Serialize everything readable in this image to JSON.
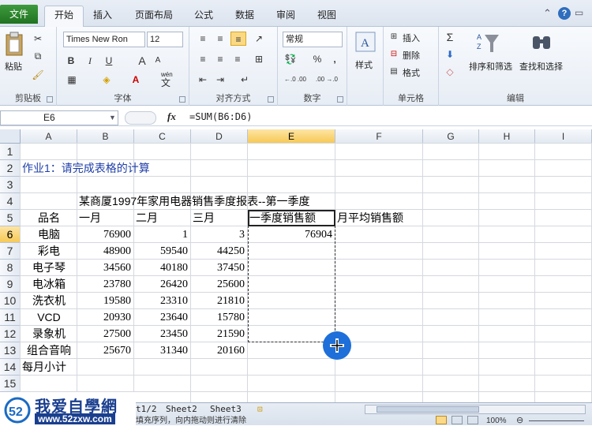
{
  "ribbon_tabs": [
    "文件",
    "开始",
    "插入",
    "页面布局",
    "公式",
    "数据",
    "审阅",
    "视图"
  ],
  "clipboard": {
    "paste": "粘贴",
    "group": "剪贴板"
  },
  "font": {
    "name": "Times New Ron",
    "size": "12",
    "group": "字体",
    "bold": "B",
    "italic": "I",
    "underline": "U",
    "grow": "A",
    "shrink": "A",
    "color": "A",
    "wen": "wén",
    "wen_glyph": "文"
  },
  "alignment": {
    "group": "对齐方式"
  },
  "number": {
    "format": "常规",
    "group": "数字",
    "percent": "%",
    "comma": ",",
    "inc": "←.0 .00",
    "dec": ".00 →.0"
  },
  "styles": {
    "label": "样式"
  },
  "cells": {
    "insert": "插入",
    "delete": "删除",
    "format": "格式",
    "group": "单元格"
  },
  "editing": {
    "sort": "排序和筛选",
    "find": "查找和选择",
    "group": "编辑",
    "sigma": "Σ"
  },
  "formula_bar": {
    "name_box": "E6",
    "fx": "fx",
    "formula": "=SUM(B6:D6)"
  },
  "columns": [
    "A",
    "B",
    "C",
    "D",
    "E",
    "F",
    "G",
    "H",
    "I"
  ],
  "rows": [
    "1",
    "2",
    "3",
    "4",
    "5",
    "6",
    "7",
    "8",
    "9",
    "10",
    "11",
    "12",
    "13",
    "14",
    "15"
  ],
  "sheet": {
    "task": "作业1：请完成表格的计算",
    "title": "某商厦1997年家用电器销售季度报表--第一季度",
    "headers": [
      "品名",
      "一月",
      "二月",
      "三月",
      "一季度销售额",
      "月平均销售额"
    ],
    "data": [
      {
        "name": "电脑",
        "b": "76900",
        "c": "1",
        "d": "3",
        "e": "76904"
      },
      {
        "name": "彩电",
        "b": "48900",
        "c": "59540",
        "d": "44250",
        "e": ""
      },
      {
        "name": "电子琴",
        "b": "34560",
        "c": "40180",
        "d": "37450",
        "e": ""
      },
      {
        "name": "电冰箱",
        "b": "23780",
        "c": "26420",
        "d": "25600",
        "e": ""
      },
      {
        "name": "洗衣机",
        "b": "19580",
        "c": "23310",
        "d": "21810",
        "e": ""
      },
      {
        "name": "VCD",
        "b": "20930",
        "c": "23640",
        "d": "15780",
        "e": ""
      },
      {
        "name": "录象机",
        "b": "27500",
        "c": "23450",
        "d": "21590",
        "e": ""
      },
      {
        "name": "组合音响",
        "b": "25670",
        "c": "31340",
        "d": "20160",
        "e": ""
      }
    ],
    "total_label": "每月小计"
  },
  "sheet_tabs": [
    "t1/2",
    "Sheet2",
    "Sheet3"
  ],
  "status_text": "填充序列，向内拖动则进行清除",
  "zoom": "100%",
  "watermark": {
    "brand": "我爱自學網",
    "url": "www.52zxw.com"
  },
  "colors": {
    "accent": "#2b579a",
    "file_tab": "#217321",
    "selection": "#f7c955",
    "cursor": "#1e6fd9"
  }
}
